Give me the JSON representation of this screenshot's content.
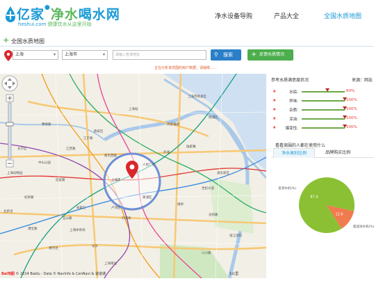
{
  "header": {
    "logo": {
      "main_part1": "亿家",
      "main_part2": "净水",
      "main_part3": "喝水网",
      "domain": "heshui.com",
      "slogan": "健康饮水从这里开始"
    },
    "nav": [
      {
        "label": "净水设备导购",
        "active": false
      },
      {
        "label": "产品大全",
        "active": false
      },
      {
        "label": "全国水质地图",
        "active": true
      }
    ]
  },
  "breadcrumb": {
    "label": "全国水质地图"
  },
  "toolbar": {
    "province": "上海",
    "city": "上海市",
    "address_placeholder": "请输入查询地址",
    "search_label": "搜索",
    "report_label": "反馈水质情况"
  },
  "notice": "正在分析该范围的用户数据，请稍候……",
  "map": {
    "labels": [
      "上海站",
      "上海市",
      "江宁路",
      "南京西路",
      "人民广场",
      "徐家汇",
      "上海体育场",
      "龙华",
      "陆家嘴",
      "世纪大道",
      "浦东新区",
      "上海南站",
      "曹杨路",
      "中山公园",
      "虹桥路",
      "延安路",
      "上海市杨浦区",
      "周家嘴路",
      "杨浦区",
      "外滩",
      "打浦桥",
      "漕河泾",
      "漕宝路",
      "宜山路",
      "上海动物园",
      "长宁区",
      "江苏路",
      "静安区",
      "黄浦区",
      "卢湾区",
      "北新泾",
      "龙阳路",
      "张江高科",
      "川沙路",
      "塘桥"
    ],
    "copyright": "© 2014 Baidu - Data © NavInfo & CenNavi & 道道通",
    "logo": "Bai地图",
    "scale": "1公里"
  },
  "quality": {
    "title": "参考水质满意度状况",
    "source": "来源：网友",
    "rows": [
      {
        "name": "水垢:",
        "value": 60,
        "display": "60%"
      },
      {
        "name": "异味:",
        "value": 100,
        "display": "100%"
      },
      {
        "name": "杂质:",
        "value": 100,
        "display": "100%"
      },
      {
        "name": "浑浊:",
        "value": 100,
        "display": "100%"
      },
      {
        "name": "爆变性:",
        "value": 100,
        "display": "100%"
      }
    ]
  },
  "usage": {
    "subtitle": "看看周围的人都在使用什么",
    "tabs": [
      {
        "label": "净水类别比例",
        "active": true
      },
      {
        "label": "品牌购买比例",
        "active": false
      }
    ]
  },
  "chart_data": {
    "type": "pie",
    "title": "",
    "slices": [
      {
        "label": "反渗水机(%)",
        "value": 87.4,
        "color": "#8bc034"
      },
      {
        "label": "超滤净水机(%)",
        "value": 12.6,
        "color": "#f07b4f"
      }
    ],
    "data_labels": [
      "87.4",
      "12.6"
    ]
  }
}
